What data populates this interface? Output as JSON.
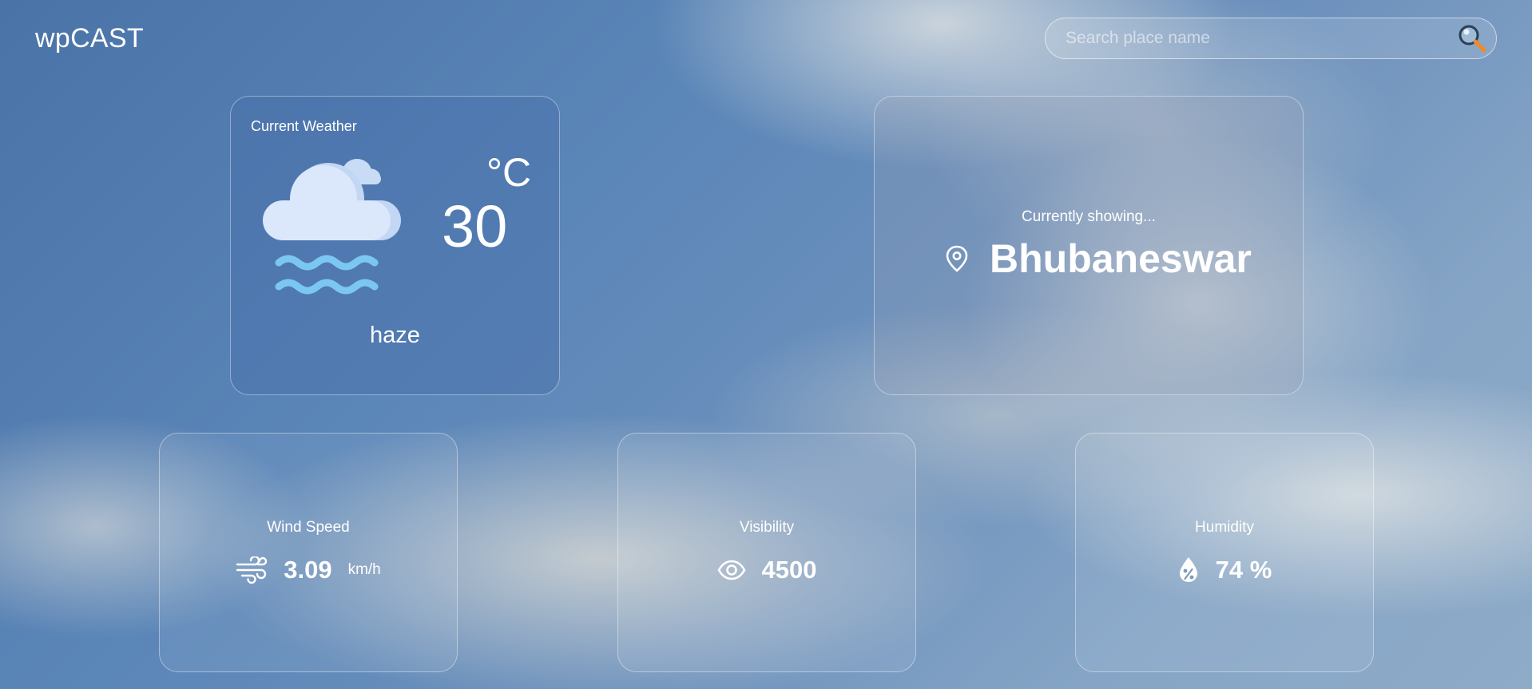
{
  "app": {
    "title": "wpCAST"
  },
  "search": {
    "placeholder": "Search place name",
    "value": ""
  },
  "current": {
    "title": "Current Weather",
    "temperature": "30",
    "unit": "°C",
    "condition": "haze",
    "icon": "haze-icon"
  },
  "location": {
    "label": "Currently showing...",
    "place": "Bhubaneswar",
    "icon": "location-pin-icon"
  },
  "stats": {
    "wind": {
      "label": "Wind Speed",
      "value": "3.09",
      "unit": "km/h",
      "icon": "wind-icon"
    },
    "visibility": {
      "label": "Visibility",
      "value": "4500",
      "icon": "eye-icon"
    },
    "humidity": {
      "label": "Humidity",
      "value": "74 %",
      "icon": "humidity-drop-icon"
    }
  },
  "colors": {
    "accent_orange": "#f08a24",
    "haze_blue": "#7cc6f2",
    "cloud": "#dbe7fb"
  }
}
